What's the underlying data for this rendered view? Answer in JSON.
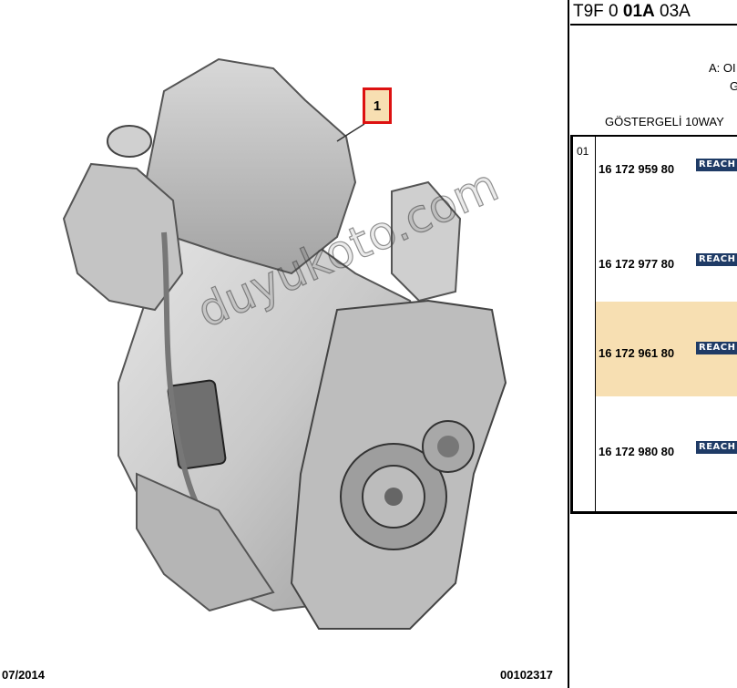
{
  "diagram": {
    "callout_number": "1",
    "watermark": "duyukoto.com",
    "footer_date": "07/2014",
    "footer_code": "00102317"
  },
  "reference": {
    "prefix": "T9F 0 ",
    "bold": "01A",
    "suffix": " 03A"
  },
  "description": {
    "line1": "A: OI",
    "line2": "G",
    "line3": "GÖSTERGELİ 10WAY"
  },
  "table": {
    "item_number": "01",
    "rows": [
      {
        "part_number": "16 172 959 80",
        "badge": "REACH",
        "highlighted": false
      },
      {
        "part_number": "16 172 977 80",
        "badge": "REACH",
        "highlighted": false
      },
      {
        "part_number": "16 172 961 80",
        "badge": "REACH",
        "highlighted": true
      },
      {
        "part_number": "16 172 980 80",
        "badge": "REACH",
        "highlighted": false
      }
    ]
  },
  "colors": {
    "highlight": "#f7dfb2",
    "callout_border": "#dd1111",
    "badge": "#1f3b66"
  }
}
